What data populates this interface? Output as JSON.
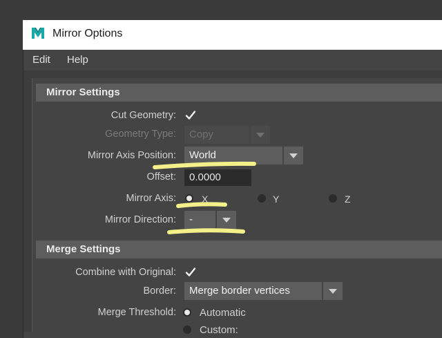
{
  "window": {
    "title": "Mirror Options",
    "icon": "maya-logo-icon"
  },
  "menu": {
    "items": [
      "Edit",
      "Help"
    ]
  },
  "mirror_settings": {
    "header": "Mirror Settings",
    "cut_geometry": {
      "label": "Cut Geometry:",
      "checked": true
    },
    "geometry_type": {
      "label": "Geometry Type:",
      "value": "Copy",
      "disabled": true
    },
    "mirror_axis_position": {
      "label": "Mirror Axis Position:",
      "value": "World"
    },
    "offset": {
      "label": "Offset:",
      "value": "0.0000"
    },
    "mirror_axis": {
      "label": "Mirror Axis:",
      "options": [
        "X",
        "Y",
        "Z"
      ],
      "selected": "X"
    },
    "mirror_direction": {
      "label": "Mirror Direction:",
      "value": "-"
    }
  },
  "merge_settings": {
    "header": "Merge Settings",
    "combine_with_original": {
      "label": "Combine with Original:",
      "checked": true
    },
    "border": {
      "label": "Border:",
      "value": "Merge border vertices"
    },
    "merge_threshold": {
      "label": "Merge Threshold:",
      "options": [
        "Automatic",
        "Custom:"
      ],
      "selected": "Automatic"
    }
  },
  "annotation_color": "#f3f08a"
}
